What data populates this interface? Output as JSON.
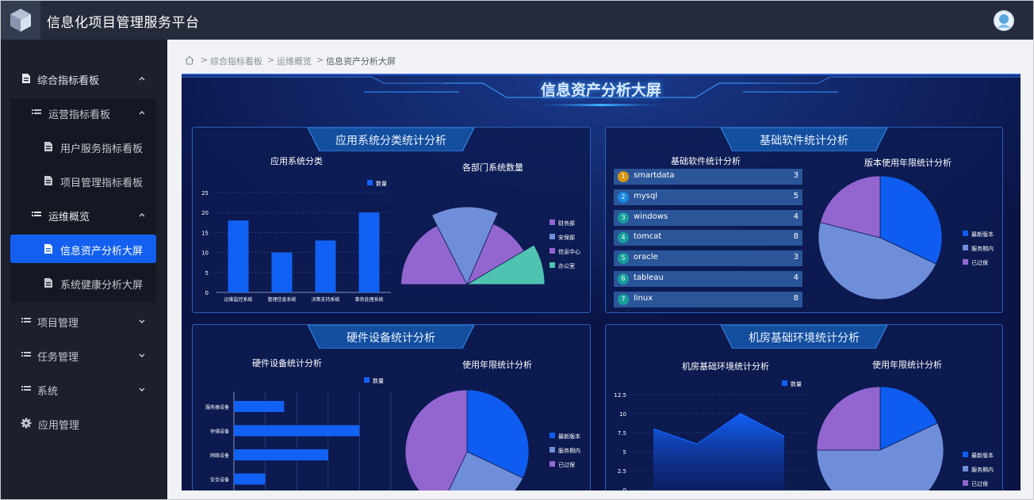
{
  "app": {
    "title": "信息化项目管理服务平台"
  },
  "sidebar": {
    "items": [
      {
        "label": "综合指标看板",
        "icon": "document-icon"
      },
      {
        "label": "运营指标看板",
        "icon": "list-icon"
      },
      {
        "label": "用户服务指标看板",
        "icon": "document-icon"
      },
      {
        "label": "项目管理指标看板",
        "icon": "document-icon"
      },
      {
        "label": "运维概览",
        "icon": "list-icon"
      },
      {
        "label": "信息资产分析大屏",
        "icon": "document-icon"
      },
      {
        "label": "系统健康分析大屏",
        "icon": "document-icon"
      },
      {
        "label": "项目管理",
        "icon": "list-icon"
      },
      {
        "label": "任务管理",
        "icon": "list-icon"
      },
      {
        "label": "系统",
        "icon": "list-icon"
      },
      {
        "label": "应用管理",
        "icon": "gear-icon"
      }
    ]
  },
  "breadcrumb": {
    "home_icon": "home-icon",
    "items": [
      "综合指标看板",
      "运维概览",
      "信息资产分析大屏"
    ],
    "separator": ">"
  },
  "screen": {
    "title": "信息资产分析大屏",
    "panels": {
      "app": {
        "title": "应用系统分类统计分析"
      },
      "software": {
        "title": "基础软件统计分析"
      },
      "hardware": {
        "title": "硬件设备统计分析"
      },
      "room": {
        "title": "机房基础环境统计分析"
      }
    }
  },
  "chart_data": [
    {
      "type": "bar",
      "title": "应用系统分类",
      "legend": [
        "数量"
      ],
      "categories": [
        "运维监控系统",
        "管理信息系统",
        "决策支持系统",
        "事务处理系统"
      ],
      "values": [
        18,
        10,
        13,
        20
      ],
      "ylim": [
        0,
        25
      ],
      "yticks": [
        "0",
        "5",
        "10",
        "15",
        "20",
        "25"
      ],
      "color": "#1261f5"
    },
    {
      "type": "pie",
      "title": "各部门系统数量",
      "legend": [
        "财务部",
        "安保部",
        "信息中心",
        "办公室"
      ],
      "colors": [
        "#9366cf",
        "#6f8ed9",
        "#9366cf",
        "#4fc2b1"
      ],
      "values": [
        35,
        28,
        20,
        17
      ],
      "note": "only upper half visible (rose/pie)"
    },
    {
      "type": "table",
      "title": "基础软件统计分析",
      "rows": [
        {
          "rank": "1",
          "name": "smartdata",
          "value": "3"
        },
        {
          "rank": "2",
          "name": "mysql",
          "value": "5"
        },
        {
          "rank": "3",
          "name": "windows",
          "value": "4"
        },
        {
          "rank": "4",
          "name": "tomcat",
          "value": "8"
        },
        {
          "rank": "5",
          "name": "oracle",
          "value": "3"
        },
        {
          "rank": "6",
          "name": "tableau",
          "value": "4"
        },
        {
          "rank": "7",
          "name": "linux",
          "value": "8"
        }
      ],
      "rank_colors": [
        "#d89614",
        "#1a87e0",
        "#16a09a",
        "#16a09a",
        "#16a09a",
        "#16a09a",
        "#16a09a"
      ]
    },
    {
      "type": "pie",
      "title": "版本使用年限统计分析",
      "legend": [
        "最新版本",
        "服务期内",
        "已过保"
      ],
      "colors": [
        "#0e5df0",
        "#6f8ed9",
        "#9366cf"
      ],
      "values": [
        32,
        47,
        21
      ]
    },
    {
      "type": "bar",
      "orientation": "horizontal",
      "title": "硬件设备统计分析",
      "legend": [
        "数量"
      ],
      "categories": [
        "服务器设备",
        "存储设备",
        "网络设备",
        "安全设备"
      ],
      "values": [
        4,
        10,
        7.5,
        2.5
      ],
      "xlim": [
        0,
        12.5
      ],
      "color": "#1261f5"
    },
    {
      "type": "pie",
      "title": "使用年限统计分析",
      "legend": [
        "最新版本",
        "服务期内",
        "已过保"
      ],
      "colors": [
        "#0e5df0",
        "#6f8ed9",
        "#9366cf"
      ],
      "values": [
        32,
        25,
        43
      ]
    },
    {
      "type": "area",
      "title": "机房基础环境统计分析",
      "legend": [
        "数量"
      ],
      "x": [
        "1",
        "2",
        "3",
        "4"
      ],
      "values": [
        8,
        6,
        10,
        7
      ],
      "ylim": [
        0,
        12.5
      ],
      "yticks": [
        "0",
        "2.5",
        "5",
        "7.5",
        "10",
        "12.5"
      ],
      "color": "#1261f5"
    },
    {
      "type": "pie",
      "title": "使用年限统计分析",
      "legend": [
        "最新版本",
        "服务期内",
        "已过保"
      ],
      "colors": [
        "#0e5df0",
        "#6f8ed9",
        "#9366cf"
      ],
      "values": [
        18,
        57,
        25
      ]
    }
  ]
}
